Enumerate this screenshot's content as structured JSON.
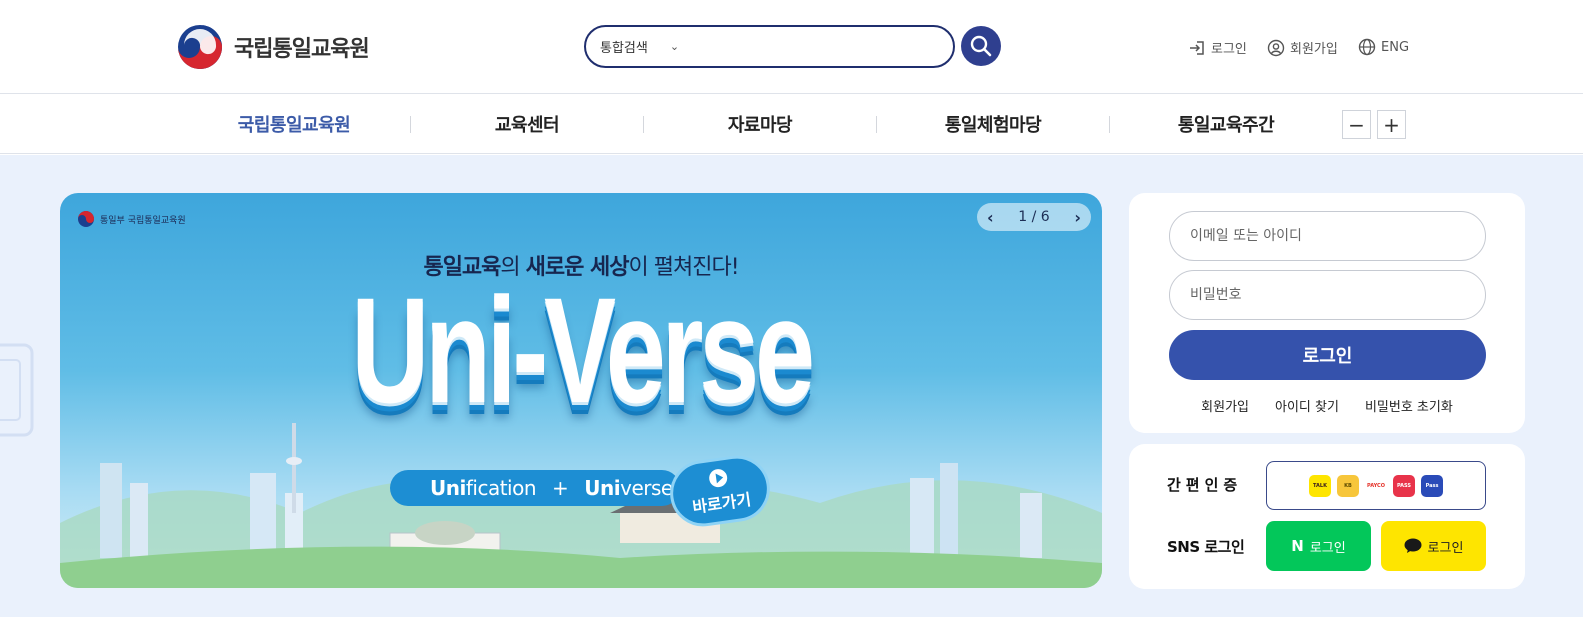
{
  "header": {
    "logo_text": "국립통일교육원",
    "search": {
      "category": "통합검색",
      "placeholder": ""
    },
    "utils": [
      {
        "icon": "login-icon",
        "label": "로그인"
      },
      {
        "icon": "user-circle-icon",
        "label": "회원가입"
      },
      {
        "icon": "globe-icon",
        "label": "ENG"
      }
    ]
  },
  "gnb": {
    "items": [
      {
        "label": "국립통일교육원",
        "active": true
      },
      {
        "label": "교육센터",
        "active": false
      },
      {
        "label": "자료마당",
        "active": false
      },
      {
        "label": "통일체험마당",
        "active": false
      },
      {
        "label": "통일교육주간",
        "active": false
      }
    ],
    "zoom_out": "−",
    "zoom_in": "+"
  },
  "banner": {
    "brand": "통일부 국립통일교육원",
    "pager": "1 / 6",
    "subtitle_strong1": "통일교육",
    "subtitle_mid1": "의 ",
    "subtitle_strong2": "새로운 세상",
    "subtitle_mid2": "이 펼쳐진다!",
    "title": "Uni-Verse",
    "pill_a_strong": "Uni",
    "pill_a_rest": "fication",
    "pill_plus": "+",
    "pill_b_strong": "Uni",
    "pill_b_rest": "verse",
    "go_label": "바로가기"
  },
  "login": {
    "id_placeholder": "이메일 또는 아이디",
    "pw_placeholder": "비밀번호",
    "submit": "로그인",
    "links": [
      "회원가입",
      "아이디 찾기",
      "비밀번호 초기화"
    ]
  },
  "cert": {
    "label": "간편인증",
    "providers": [
      "TALK",
      "KB",
      "PAYCO",
      "PASS",
      "Pass"
    ]
  },
  "sns": {
    "label": "SNS 로그인",
    "naver_label": "로그인",
    "kakao_label": "로그인"
  },
  "colors": {
    "primary": "#3552ac",
    "gnb_active": "#3c5ba8",
    "search_border": "#1f2e6e",
    "naver": "#03c75a",
    "kakao": "#fee500",
    "main_bg": "#eaf1fc"
  }
}
